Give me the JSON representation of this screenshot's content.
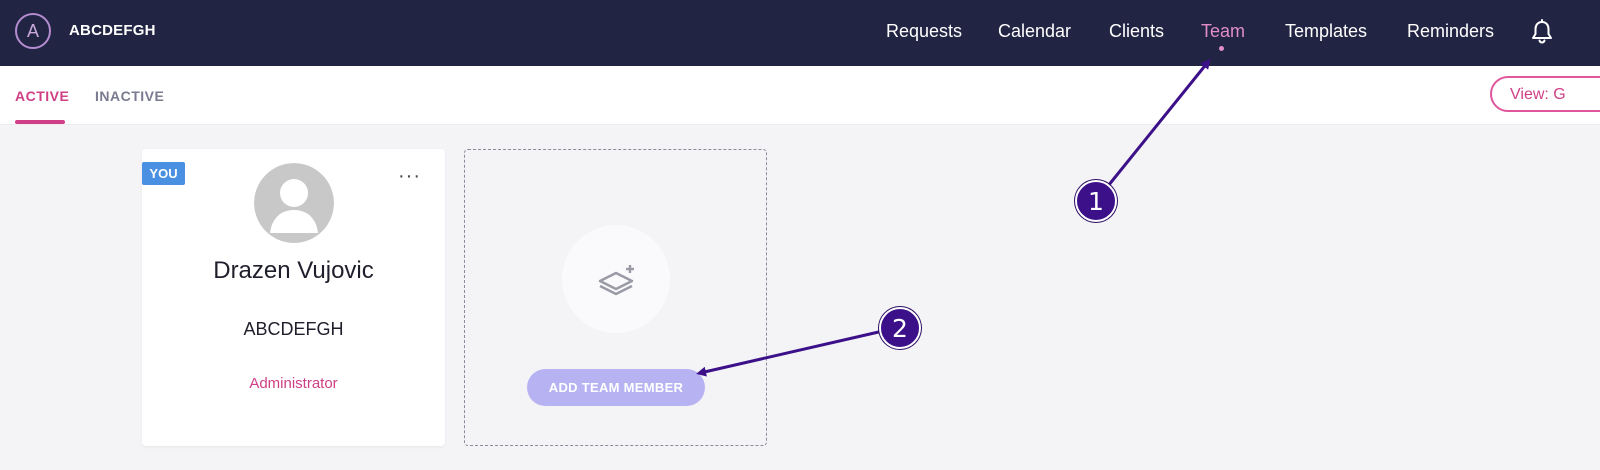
{
  "header": {
    "logo_letter": "A",
    "brand": "ABCDEFGH",
    "nav": [
      "Requests",
      "Calendar",
      "Clients",
      "Team",
      "Templates",
      "Reminders"
    ],
    "active_nav": "Team",
    "bell_icon": "bell-icon"
  },
  "tabs": {
    "active": "ACTIVE",
    "inactive": "INACTIVE",
    "view_button": "View: G"
  },
  "member_card": {
    "badge": "YOU",
    "name": "Drazen Vujovic",
    "org": "ABCDEFGH",
    "role": "Administrator",
    "more": "···"
  },
  "add_card": {
    "button": "ADD TEAM MEMBER",
    "icon": "layers-plus-icon"
  },
  "annotations": [
    "1",
    "2"
  ],
  "colors": {
    "navbar": "#212443",
    "accent": "#cf3f86",
    "badge": "#4a90e2",
    "add_button": "#b7b3f3",
    "annotation": "#3c1089"
  }
}
